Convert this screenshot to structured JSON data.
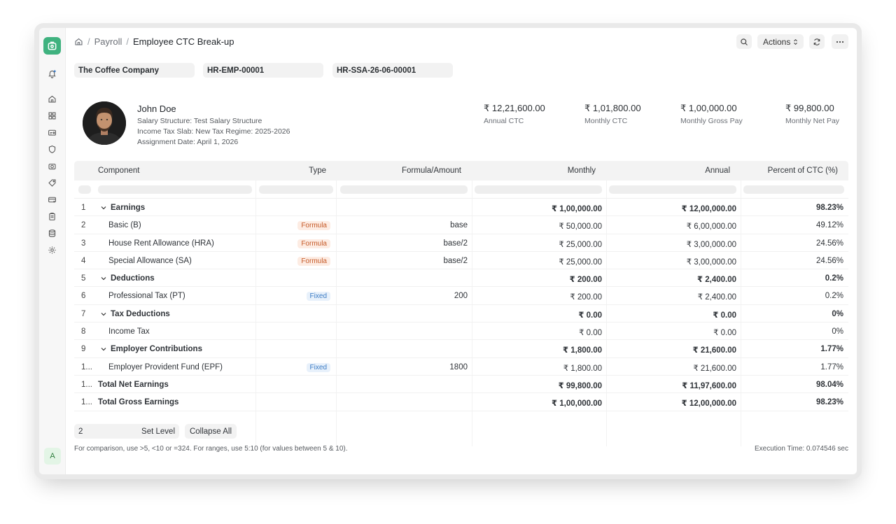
{
  "breadcrumb": {
    "parent": "Payroll",
    "current": "Employee CTC Break-up"
  },
  "toolbar": {
    "actions_label": "Actions"
  },
  "filters": {
    "company": "The Coffee Company",
    "employee": "HR-EMP-00001",
    "assignment": "HR-SSA-26-06-00001"
  },
  "employee": {
    "name": "John Doe",
    "salary_structure": "Salary Structure: Test Salary Structure",
    "tax_slab": "Income Tax Slab: New Tax Regime: 2025-2026",
    "assignment_date": "Assignment Date: April 1, 2026"
  },
  "stats": [
    {
      "value": "₹ 12,21,600.00",
      "label": "Annual CTC"
    },
    {
      "value": "₹ 1,01,800.00",
      "label": "Monthly CTC"
    },
    {
      "value": "₹ 1,00,000.00",
      "label": "Monthly Gross Pay"
    },
    {
      "value": "₹ 99,800.00",
      "label": "Monthly Net Pay"
    }
  ],
  "table": {
    "headers": {
      "component": "Component",
      "type": "Type",
      "formula": "Formula/Amount",
      "monthly": "Monthly",
      "annual": "Annual",
      "pct": "Percent of CTC (%)"
    },
    "rows": [
      {
        "idx": "1",
        "component": "Earnings",
        "type": "",
        "formula": "",
        "monthly": "₹ 1,00,000.00",
        "annual": "₹ 12,00,000.00",
        "pct": "98.23%"
      },
      {
        "idx": "2",
        "component": "Basic (B)",
        "type": "Formula",
        "formula": "base",
        "monthly": "₹ 50,000.00",
        "annual": "₹ 6,00,000.00",
        "pct": "49.12%"
      },
      {
        "idx": "3",
        "component": "House Rent Allowance (HRA)",
        "type": "Formula",
        "formula": "base/2",
        "monthly": "₹ 25,000.00",
        "annual": "₹ 3,00,000.00",
        "pct": "24.56%"
      },
      {
        "idx": "4",
        "component": "Special Allowance (SA)",
        "type": "Formula",
        "formula": "base/2",
        "monthly": "₹ 25,000.00",
        "annual": "₹ 3,00,000.00",
        "pct": "24.56%"
      },
      {
        "idx": "5",
        "component": "Deductions",
        "type": "",
        "formula": "",
        "monthly": "₹ 200.00",
        "annual": "₹ 2,400.00",
        "pct": "0.2%"
      },
      {
        "idx": "6",
        "component": "Professional Tax (PT)",
        "type": "Fixed",
        "formula": "200",
        "monthly": "₹ 200.00",
        "annual": "₹ 2,400.00",
        "pct": "0.2%"
      },
      {
        "idx": "7",
        "component": "Tax Deductions",
        "type": "",
        "formula": "",
        "monthly": "₹ 0.00",
        "annual": "₹ 0.00",
        "pct": "0%"
      },
      {
        "idx": "8",
        "component": "Income Tax",
        "type": "",
        "formula": "",
        "monthly": "₹ 0.00",
        "annual": "₹ 0.00",
        "pct": "0%"
      },
      {
        "idx": "9",
        "component": "Employer Contributions",
        "type": "",
        "formula": "",
        "monthly": "₹ 1,800.00",
        "annual": "₹ 21,600.00",
        "pct": "1.77%"
      },
      {
        "idx": "1...",
        "component": "Employer Provident Fund (EPF)",
        "type": "Fixed",
        "formula": "1800",
        "monthly": "₹ 1,800.00",
        "annual": "₹ 21,600.00",
        "pct": "1.77%"
      },
      {
        "idx": "1...",
        "component": "Total Net Earnings",
        "type": "",
        "formula": "",
        "monthly": "₹ 99,800.00",
        "annual": "₹ 11,97,600.00",
        "pct": "98.04%"
      },
      {
        "idx": "1...",
        "component": "Total Gross Earnings",
        "type": "",
        "formula": "",
        "monthly": "₹ 1,00,000.00",
        "annual": "₹ 12,00,000.00",
        "pct": "98.23%"
      }
    ]
  },
  "footer": {
    "level_value": "2",
    "set_level_label": "Set Level",
    "collapse_label": "Collapse All",
    "hint": "For comparison, use >5, <10 or =324. For ranges, use 5:10 (for values between 5 & 10).",
    "execution_time": "Execution Time: 0.074546 sec"
  },
  "user_initial": "A",
  "colors": {
    "brand": "#3fb27f",
    "formula_badge": "#c55a28",
    "fixed_badge": "#3b7bc4"
  }
}
